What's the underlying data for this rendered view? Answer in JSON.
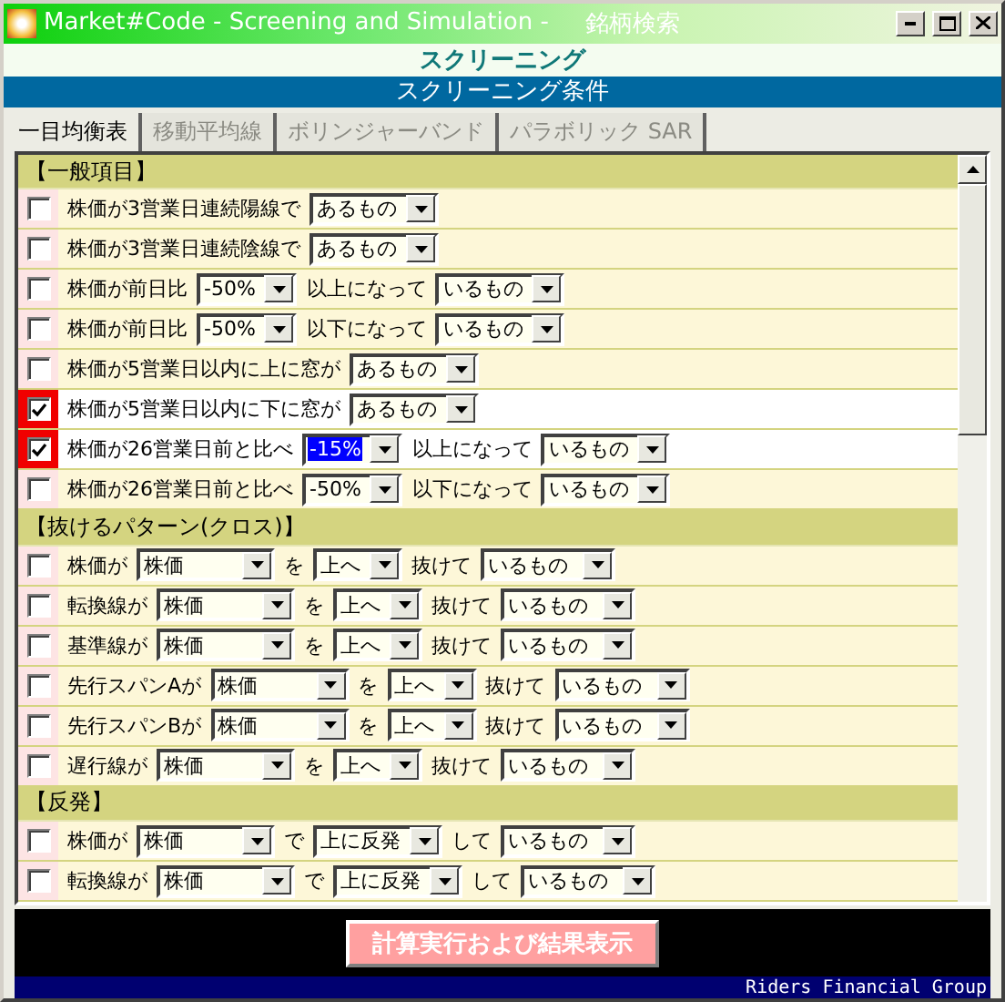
{
  "window": {
    "title": "Market#Code  - Screening and Simulation -",
    "subtitle": "銘柄検索"
  },
  "header": "スクリーニング",
  "section_bar": "スクリーニング条件",
  "tabs": [
    {
      "label": "一目均衡表",
      "selected": true
    },
    {
      "label": "移動平均線",
      "selected": false
    },
    {
      "label": "ボリンジャーバンド",
      "selected": false
    },
    {
      "label": "パラボリック SAR",
      "selected": false
    }
  ],
  "groups": [
    {
      "title": "【一般項目】",
      "rows": [
        {
          "checked": false,
          "parts": [
            {
              "kind": "text",
              "text": "株価が3営業日連続陽線で"
            },
            {
              "kind": "select",
              "value": "あるもの",
              "focused": false
            }
          ]
        },
        {
          "checked": false,
          "parts": [
            {
              "kind": "text",
              "text": "株価が3営業日連続陰線で"
            },
            {
              "kind": "select",
              "value": "あるもの",
              "focused": false
            }
          ]
        },
        {
          "checked": false,
          "parts": [
            {
              "kind": "text",
              "text": "株価が前日比"
            },
            {
              "kind": "select",
              "value": "-50%",
              "focused": false
            },
            {
              "kind": "text",
              "text": "以上になって"
            },
            {
              "kind": "select",
              "value": "いるもの",
              "focused": false
            }
          ]
        },
        {
          "checked": false,
          "parts": [
            {
              "kind": "text",
              "text": "株価が前日比"
            },
            {
              "kind": "select",
              "value": "-50%",
              "focused": false
            },
            {
              "kind": "text",
              "text": "以下になって"
            },
            {
              "kind": "select",
              "value": "いるもの",
              "focused": false
            }
          ]
        },
        {
          "checked": false,
          "parts": [
            {
              "kind": "text",
              "text": "株価が5営業日以内に上に窓が"
            },
            {
              "kind": "select",
              "value": "あるもの",
              "focused": false
            }
          ]
        },
        {
          "checked": true,
          "parts": [
            {
              "kind": "text",
              "text": "株価が5営業日以内に下に窓が"
            },
            {
              "kind": "select",
              "value": "あるもの",
              "focused": false
            }
          ]
        },
        {
          "checked": true,
          "parts": [
            {
              "kind": "text",
              "text": "株価が26営業日前と比べ"
            },
            {
              "kind": "select",
              "value": "-15%",
              "focused": true
            },
            {
              "kind": "text",
              "text": "以上になって"
            },
            {
              "kind": "select",
              "value": "いるもの",
              "focused": false
            }
          ]
        },
        {
          "checked": false,
          "parts": [
            {
              "kind": "text",
              "text": "株価が26営業日前と比べ"
            },
            {
              "kind": "select",
              "value": "-50%",
              "focused": false
            },
            {
              "kind": "text",
              "text": "以下になって"
            },
            {
              "kind": "select",
              "value": "いるもの",
              "focused": false
            }
          ]
        }
      ]
    },
    {
      "title": "【抜けるパターン(クロス)】",
      "rows": [
        {
          "checked": false,
          "parts": [
            {
              "kind": "text",
              "text": "株価が"
            },
            {
              "kind": "select",
              "value": "株価",
              "focused": false
            },
            {
              "kind": "text",
              "text": "を"
            },
            {
              "kind": "select",
              "value": "上へ",
              "focused": false
            },
            {
              "kind": "text",
              "text": "抜けて"
            },
            {
              "kind": "select",
              "value": "いるもの",
              "focused": false
            }
          ]
        },
        {
          "checked": false,
          "parts": [
            {
              "kind": "text",
              "text": "転換線が"
            },
            {
              "kind": "select",
              "value": "株価",
              "focused": false
            },
            {
              "kind": "text",
              "text": "を"
            },
            {
              "kind": "select",
              "value": "上へ",
              "focused": false
            },
            {
              "kind": "text",
              "text": "抜けて"
            },
            {
              "kind": "select",
              "value": "いるもの",
              "focused": false
            }
          ]
        },
        {
          "checked": false,
          "parts": [
            {
              "kind": "text",
              "text": "基準線が"
            },
            {
              "kind": "select",
              "value": "株価",
              "focused": false
            },
            {
              "kind": "text",
              "text": "を"
            },
            {
              "kind": "select",
              "value": "上へ",
              "focused": false
            },
            {
              "kind": "text",
              "text": "抜けて"
            },
            {
              "kind": "select",
              "value": "いるもの",
              "focused": false
            }
          ]
        },
        {
          "checked": false,
          "parts": [
            {
              "kind": "text",
              "text": "先行スパンAが"
            },
            {
              "kind": "select",
              "value": "株価",
              "focused": false
            },
            {
              "kind": "text",
              "text": "を"
            },
            {
              "kind": "select",
              "value": "上へ",
              "focused": false
            },
            {
              "kind": "text",
              "text": "抜けて"
            },
            {
              "kind": "select",
              "value": "いるもの",
              "focused": false
            }
          ]
        },
        {
          "checked": false,
          "parts": [
            {
              "kind": "text",
              "text": "先行スパンBが"
            },
            {
              "kind": "select",
              "value": "株価",
              "focused": false
            },
            {
              "kind": "text",
              "text": "を"
            },
            {
              "kind": "select",
              "value": "上へ",
              "focused": false
            },
            {
              "kind": "text",
              "text": "抜けて"
            },
            {
              "kind": "select",
              "value": "いるもの",
              "focused": false
            }
          ]
        },
        {
          "checked": false,
          "parts": [
            {
              "kind": "text",
              "text": "遅行線が"
            },
            {
              "kind": "select",
              "value": "株価",
              "focused": false
            },
            {
              "kind": "text",
              "text": "を"
            },
            {
              "kind": "select",
              "value": "上へ",
              "focused": false
            },
            {
              "kind": "text",
              "text": "抜けて"
            },
            {
              "kind": "select",
              "value": "いるもの",
              "focused": false
            }
          ]
        }
      ]
    },
    {
      "title": "【反発】",
      "rows": [
        {
          "checked": false,
          "parts": [
            {
              "kind": "text",
              "text": "株価が"
            },
            {
              "kind": "select",
              "value": "株価",
              "focused": false
            },
            {
              "kind": "text",
              "text": "で"
            },
            {
              "kind": "select",
              "value": "上に反発",
              "focused": false
            },
            {
              "kind": "text",
              "text": "して"
            },
            {
              "kind": "select",
              "value": "いるもの",
              "focused": false
            }
          ]
        },
        {
          "checked": false,
          "parts": [
            {
              "kind": "text",
              "text": "転換線が"
            },
            {
              "kind": "select",
              "value": "株価",
              "focused": false
            },
            {
              "kind": "text",
              "text": "で"
            },
            {
              "kind": "select",
              "value": "上に反発",
              "focused": false
            },
            {
              "kind": "text",
              "text": "して"
            },
            {
              "kind": "select",
              "value": "いるもの",
              "focused": false
            }
          ]
        }
      ]
    }
  ],
  "run_button": "計算実行および結果表示",
  "status_bar": "Riders Financial Group"
}
